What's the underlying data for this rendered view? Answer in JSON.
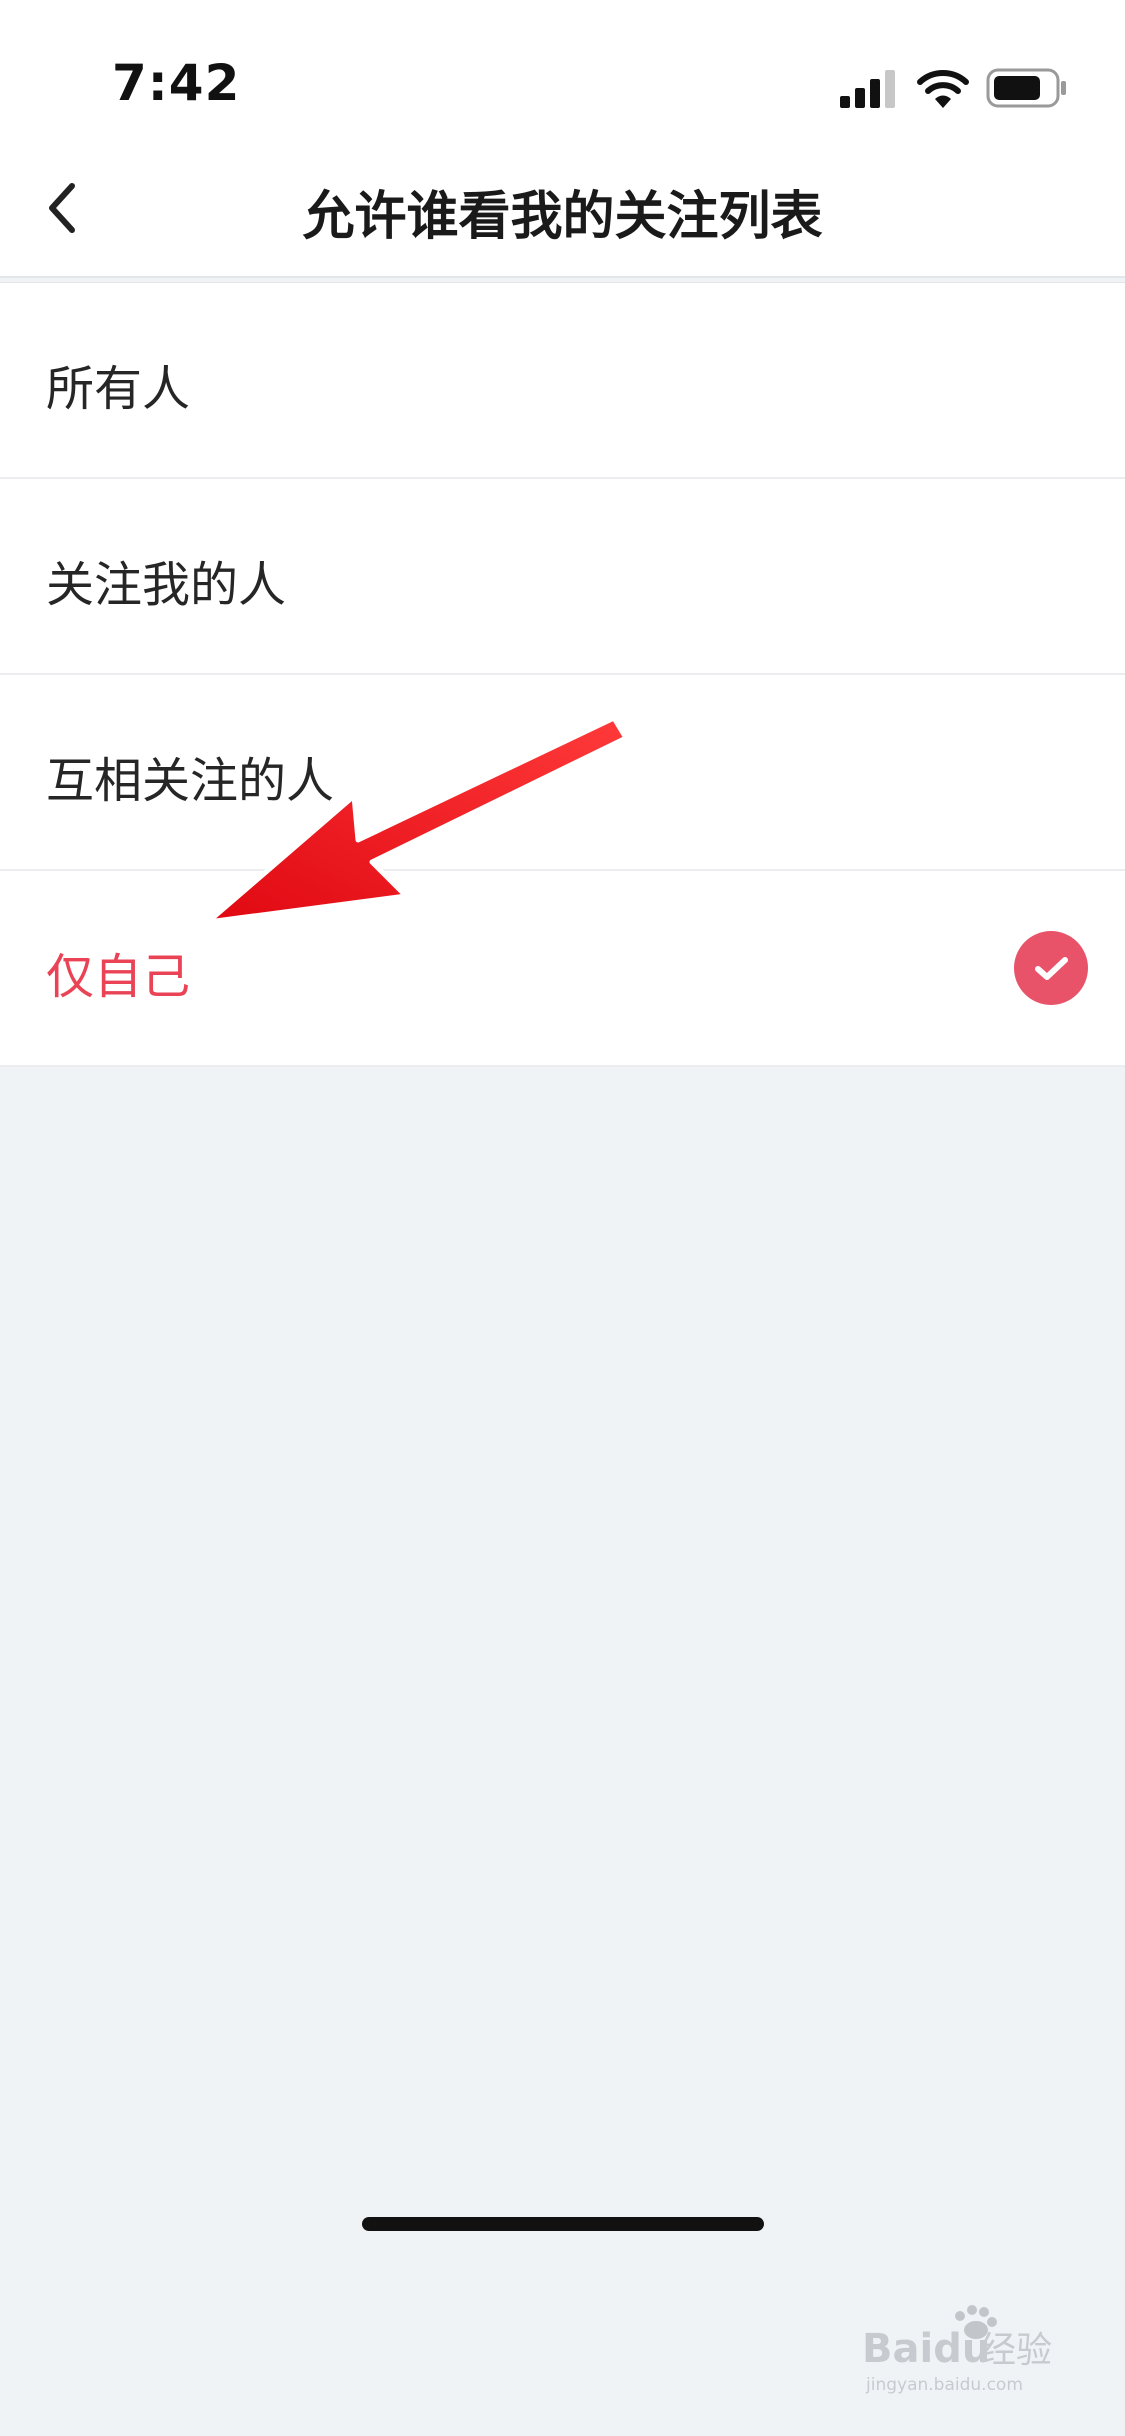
{
  "status_bar": {
    "time": "7:42",
    "icons": [
      "signal-icon",
      "wifi-icon",
      "battery-icon"
    ]
  },
  "nav": {
    "back_icon": "chevron-left-icon",
    "title": "允许谁看我的关注列表"
  },
  "options": [
    {
      "label": "所有人",
      "selected": false
    },
    {
      "label": "关注我的人",
      "selected": false
    },
    {
      "label": "互相关注的人",
      "selected": false
    },
    {
      "label": "仅自己",
      "selected": true
    }
  ],
  "colors": {
    "accent": "#ea4356",
    "check_bg": "#e8536a",
    "page_bg": "#f0f3f6",
    "arrow": "#f0101a"
  },
  "watermark": {
    "logo_text": "Baidu经验",
    "url": "jingyan.baidu.com"
  }
}
